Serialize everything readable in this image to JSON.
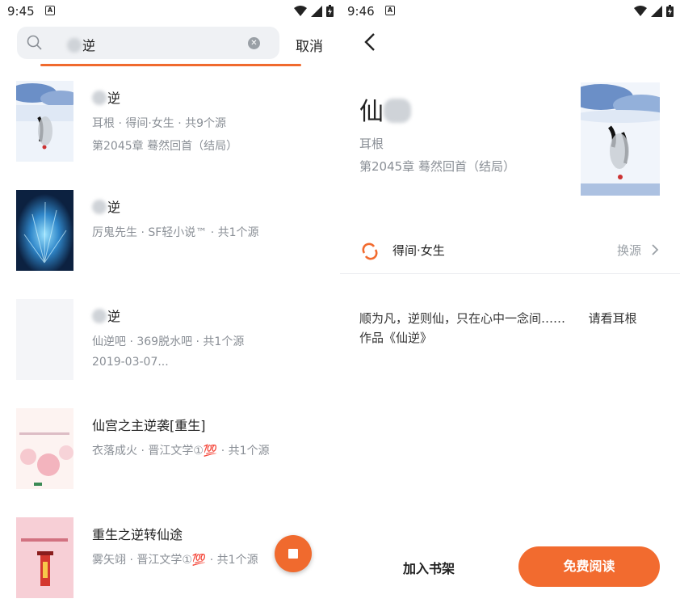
{
  "left": {
    "status": {
      "time": "9:45",
      "notif_letter": "A"
    },
    "search": {
      "query": "逆",
      "cancel": "取消"
    },
    "results": [
      {
        "title": "逆",
        "meta": "耳根 · 得间·女生 · 共9个源",
        "chapter": "第2045章 蓦然回首（结局）"
      },
      {
        "title": "逆",
        "meta": "厉鬼先生 · SF轻小说™ · 共1个源",
        "chapter": ""
      },
      {
        "title": "逆",
        "meta": "仙逆吧 · 369脱水吧 · 共1个源",
        "chapter": "2019-03-07..."
      },
      {
        "title": "仙宫之主逆袭[重生]",
        "meta": "衣落成火 · 晋江文学①💯 · 共1个源",
        "chapter": ""
      },
      {
        "title": "重生之逆转仙途",
        "meta": "雾矢翊 · 晋江文学①💯 · 共1个源",
        "chapter": ""
      }
    ]
  },
  "right": {
    "status": {
      "time": "9:46",
      "notif_letter": "A"
    },
    "book": {
      "title": "仙",
      "author": "耳根",
      "latest_chapter": "第2045章 蓦然回首（结局）"
    },
    "source": {
      "name": "得间·女生",
      "switch_label": "换源"
    },
    "description": "顺为凡，逆则仙，只在心中一念间……      请看耳根\n作品《仙逆》",
    "actions": {
      "shelf": "加入书架",
      "read": "免费阅读"
    },
    "accent": "#f26b2f"
  }
}
